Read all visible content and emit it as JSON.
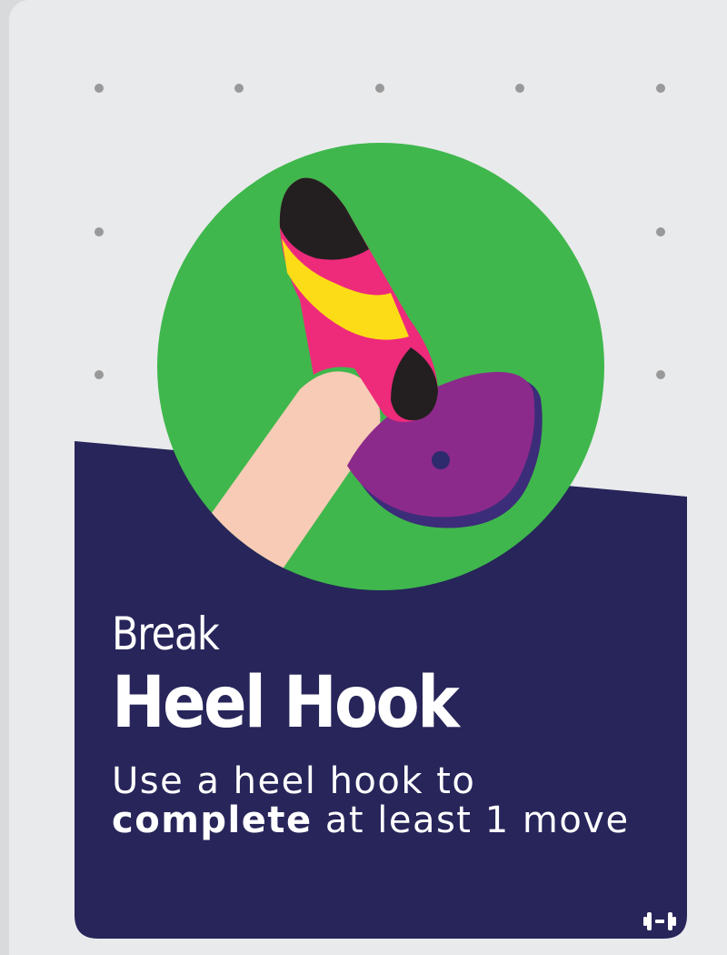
{
  "card": {
    "category": "Break",
    "title": "Heel Hook",
    "description": {
      "part1": "Use a heel hook to",
      "emphasis": "complete",
      "part2": "at least 1 move"
    },
    "badge_icon": "dumbbell-icon"
  },
  "colors": {
    "card_background": "#e9eaec",
    "panel": "#27255a",
    "circle": "#3fb74c",
    "leg": "#f7cbb5",
    "shoe": "#ee2a7b",
    "shoe_stripe": "#fcdc17",
    "shoe_rubber": "#231f20",
    "hold": "#8c2a8b",
    "hold_shadow": "#3b2d79",
    "dots": "#999999",
    "text": "#ffffff"
  }
}
